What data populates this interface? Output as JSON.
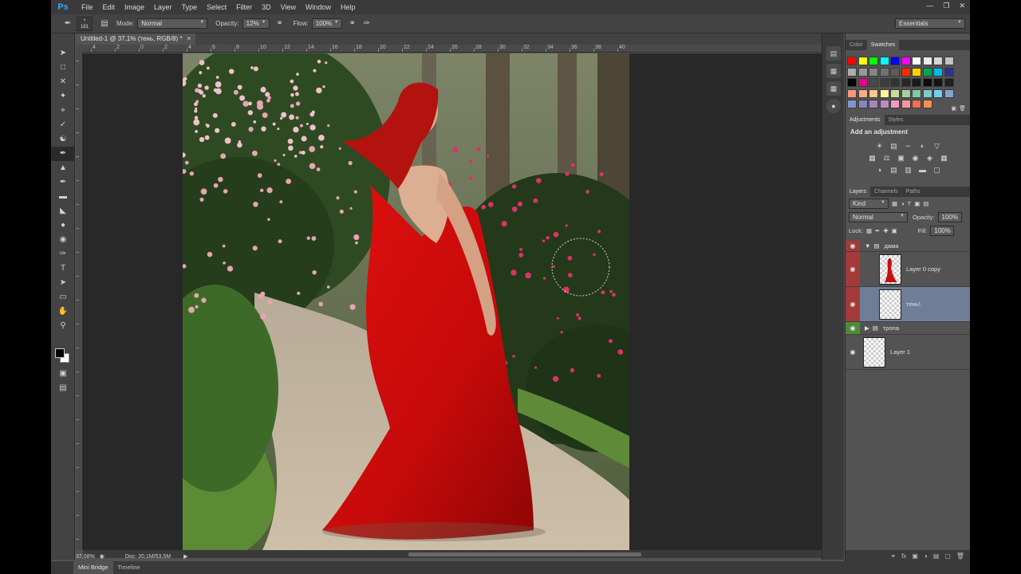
{
  "app": {
    "logo": "Ps"
  },
  "menu": [
    "File",
    "Edit",
    "Image",
    "Layer",
    "Type",
    "Select",
    "Filter",
    "3D",
    "View",
    "Window",
    "Help"
  ],
  "options": {
    "brush_size": "181",
    "mode_label": "Mode:",
    "mode_value": "Normal",
    "opacity_label": "Opacity:",
    "opacity_value": "12%",
    "flow_label": "Flow:",
    "flow_value": "100%",
    "workspace": "Essentials"
  },
  "document": {
    "tab_title": "Untitled-1 @ 37,1% (тень, RGB/8) *",
    "ruler_h": [
      "4",
      "2",
      "0",
      "2",
      "4",
      "6",
      "8",
      "10",
      "12",
      "14",
      "16",
      "18",
      "20",
      "22",
      "24",
      "26",
      "28",
      "30",
      "32",
      "34",
      "36",
      "38",
      "40"
    ],
    "zoom": "37,08%",
    "doc_info": "Doc: 20,1M/53,5M"
  },
  "bottom_tabs": [
    "Mini Bridge",
    "Timeline"
  ],
  "color_panel": {
    "tabs": [
      "Color",
      "Swatches"
    ]
  },
  "swatches": [
    "#ff0000",
    "#ffff00",
    "#00ff00",
    "#00ffff",
    "#0000ff",
    "#ff00ff",
    "#ffffff",
    "#ebebeb",
    "#d6d6d6",
    "#c2c2c2",
    "#adadad",
    "#999999",
    "#858585",
    "#707070",
    "#5c5c5c",
    "#ff2a00",
    "#ffd200",
    "#00a651",
    "#00b7ef",
    "#2e3192",
    "#000000",
    "#ec008c",
    "#4a4a4a",
    "#3d3d3d",
    "#333333",
    "#262626",
    "#1a1a1a",
    "#0d0d0d",
    "#141414",
    "#202020",
    "#f7977a",
    "#f9ad81",
    "#fdc68a",
    "#fff79a",
    "#c4df9b",
    "#a3d39c",
    "#82ca9d",
    "#7bcdc8",
    "#6ecff6",
    "#7ea7d8",
    "#8493ca",
    "#8882be",
    "#a187be",
    "#bc8dbf",
    "#f49ac2",
    "#f6989d",
    "#f26c4f",
    "#f68e55"
  ],
  "adjustments": {
    "tabs": [
      "Adjustments",
      "Styles"
    ],
    "title": "Add an adjustment"
  },
  "layers_panel": {
    "tabs": [
      "Layers",
      "Channels",
      "Paths"
    ],
    "filter": "Kind",
    "blend": "Normal",
    "opacity_label": "Opacity:",
    "opacity_value": "100%",
    "lock_label": "Lock:",
    "fill_label": "Fill:",
    "fill_value": "100%",
    "layers": [
      {
        "name": "дама",
        "type": "group",
        "tag": "red"
      },
      {
        "name": "Layer 0 copy",
        "type": "layer",
        "tag": "red"
      },
      {
        "name": "тень\\",
        "type": "layer",
        "tag": "red",
        "selected": true
      },
      {
        "name": "тропа",
        "type": "group",
        "tag": "green"
      },
      {
        "name": "Layer 1",
        "type": "layer",
        "tag": "none"
      }
    ]
  }
}
